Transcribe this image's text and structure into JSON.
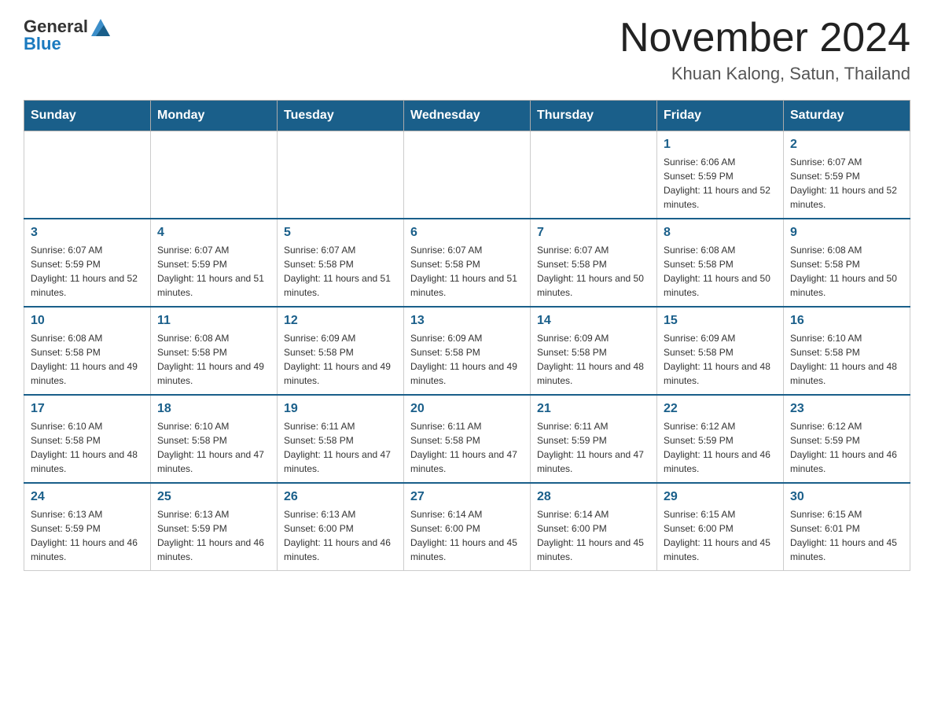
{
  "header": {
    "logo_general": "General",
    "logo_blue": "Blue",
    "title": "November 2024",
    "location": "Khuan Kalong, Satun, Thailand"
  },
  "days_of_week": [
    "Sunday",
    "Monday",
    "Tuesday",
    "Wednesday",
    "Thursday",
    "Friday",
    "Saturday"
  ],
  "weeks": [
    [
      {
        "day": "",
        "info": ""
      },
      {
        "day": "",
        "info": ""
      },
      {
        "day": "",
        "info": ""
      },
      {
        "day": "",
        "info": ""
      },
      {
        "day": "",
        "info": ""
      },
      {
        "day": "1",
        "info": "Sunrise: 6:06 AM\nSunset: 5:59 PM\nDaylight: 11 hours and 52 minutes."
      },
      {
        "day": "2",
        "info": "Sunrise: 6:07 AM\nSunset: 5:59 PM\nDaylight: 11 hours and 52 minutes."
      }
    ],
    [
      {
        "day": "3",
        "info": "Sunrise: 6:07 AM\nSunset: 5:59 PM\nDaylight: 11 hours and 52 minutes."
      },
      {
        "day": "4",
        "info": "Sunrise: 6:07 AM\nSunset: 5:59 PM\nDaylight: 11 hours and 51 minutes."
      },
      {
        "day": "5",
        "info": "Sunrise: 6:07 AM\nSunset: 5:58 PM\nDaylight: 11 hours and 51 minutes."
      },
      {
        "day": "6",
        "info": "Sunrise: 6:07 AM\nSunset: 5:58 PM\nDaylight: 11 hours and 51 minutes."
      },
      {
        "day": "7",
        "info": "Sunrise: 6:07 AM\nSunset: 5:58 PM\nDaylight: 11 hours and 50 minutes."
      },
      {
        "day": "8",
        "info": "Sunrise: 6:08 AM\nSunset: 5:58 PM\nDaylight: 11 hours and 50 minutes."
      },
      {
        "day": "9",
        "info": "Sunrise: 6:08 AM\nSunset: 5:58 PM\nDaylight: 11 hours and 50 minutes."
      }
    ],
    [
      {
        "day": "10",
        "info": "Sunrise: 6:08 AM\nSunset: 5:58 PM\nDaylight: 11 hours and 49 minutes."
      },
      {
        "day": "11",
        "info": "Sunrise: 6:08 AM\nSunset: 5:58 PM\nDaylight: 11 hours and 49 minutes."
      },
      {
        "day": "12",
        "info": "Sunrise: 6:09 AM\nSunset: 5:58 PM\nDaylight: 11 hours and 49 minutes."
      },
      {
        "day": "13",
        "info": "Sunrise: 6:09 AM\nSunset: 5:58 PM\nDaylight: 11 hours and 49 minutes."
      },
      {
        "day": "14",
        "info": "Sunrise: 6:09 AM\nSunset: 5:58 PM\nDaylight: 11 hours and 48 minutes."
      },
      {
        "day": "15",
        "info": "Sunrise: 6:09 AM\nSunset: 5:58 PM\nDaylight: 11 hours and 48 minutes."
      },
      {
        "day": "16",
        "info": "Sunrise: 6:10 AM\nSunset: 5:58 PM\nDaylight: 11 hours and 48 minutes."
      }
    ],
    [
      {
        "day": "17",
        "info": "Sunrise: 6:10 AM\nSunset: 5:58 PM\nDaylight: 11 hours and 48 minutes."
      },
      {
        "day": "18",
        "info": "Sunrise: 6:10 AM\nSunset: 5:58 PM\nDaylight: 11 hours and 47 minutes."
      },
      {
        "day": "19",
        "info": "Sunrise: 6:11 AM\nSunset: 5:58 PM\nDaylight: 11 hours and 47 minutes."
      },
      {
        "day": "20",
        "info": "Sunrise: 6:11 AM\nSunset: 5:58 PM\nDaylight: 11 hours and 47 minutes."
      },
      {
        "day": "21",
        "info": "Sunrise: 6:11 AM\nSunset: 5:59 PM\nDaylight: 11 hours and 47 minutes."
      },
      {
        "day": "22",
        "info": "Sunrise: 6:12 AM\nSunset: 5:59 PM\nDaylight: 11 hours and 46 minutes."
      },
      {
        "day": "23",
        "info": "Sunrise: 6:12 AM\nSunset: 5:59 PM\nDaylight: 11 hours and 46 minutes."
      }
    ],
    [
      {
        "day": "24",
        "info": "Sunrise: 6:13 AM\nSunset: 5:59 PM\nDaylight: 11 hours and 46 minutes."
      },
      {
        "day": "25",
        "info": "Sunrise: 6:13 AM\nSunset: 5:59 PM\nDaylight: 11 hours and 46 minutes."
      },
      {
        "day": "26",
        "info": "Sunrise: 6:13 AM\nSunset: 6:00 PM\nDaylight: 11 hours and 46 minutes."
      },
      {
        "day": "27",
        "info": "Sunrise: 6:14 AM\nSunset: 6:00 PM\nDaylight: 11 hours and 45 minutes."
      },
      {
        "day": "28",
        "info": "Sunrise: 6:14 AM\nSunset: 6:00 PM\nDaylight: 11 hours and 45 minutes."
      },
      {
        "day": "29",
        "info": "Sunrise: 6:15 AM\nSunset: 6:00 PM\nDaylight: 11 hours and 45 minutes."
      },
      {
        "day": "30",
        "info": "Sunrise: 6:15 AM\nSunset: 6:01 PM\nDaylight: 11 hours and 45 minutes."
      }
    ]
  ]
}
